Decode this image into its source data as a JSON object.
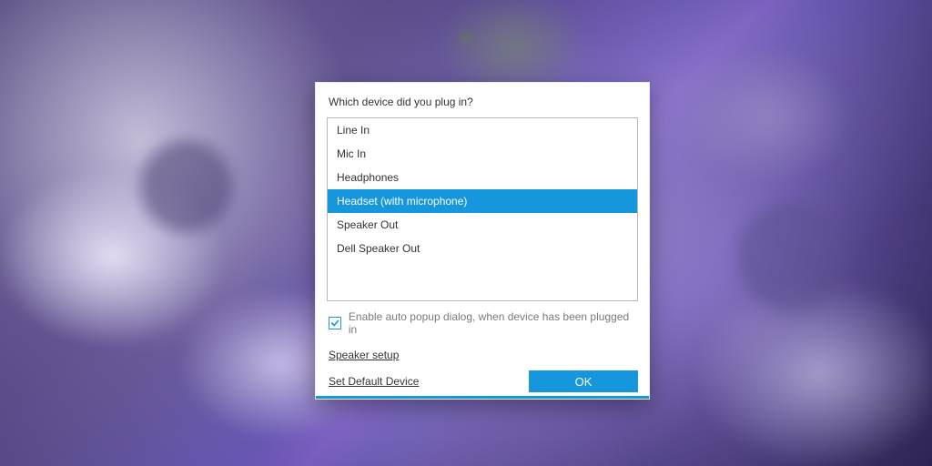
{
  "dialog": {
    "title": "Which device did you plug in?",
    "devices": [
      {
        "label": "Line In",
        "selected": false
      },
      {
        "label": "Mic In",
        "selected": false
      },
      {
        "label": "Headphones",
        "selected": false
      },
      {
        "label": "Headset (with microphone)",
        "selected": true
      },
      {
        "label": "Speaker Out",
        "selected": false
      },
      {
        "label": "Dell Speaker Out",
        "selected": false
      }
    ],
    "auto_popup": {
      "checked": true,
      "label": "Enable auto popup dialog, when device has been plugged in"
    },
    "links": {
      "speaker_setup": "Speaker setup",
      "set_default": "Set Default Device"
    },
    "ok_label": "OK",
    "accent_color": "#1596dd"
  }
}
